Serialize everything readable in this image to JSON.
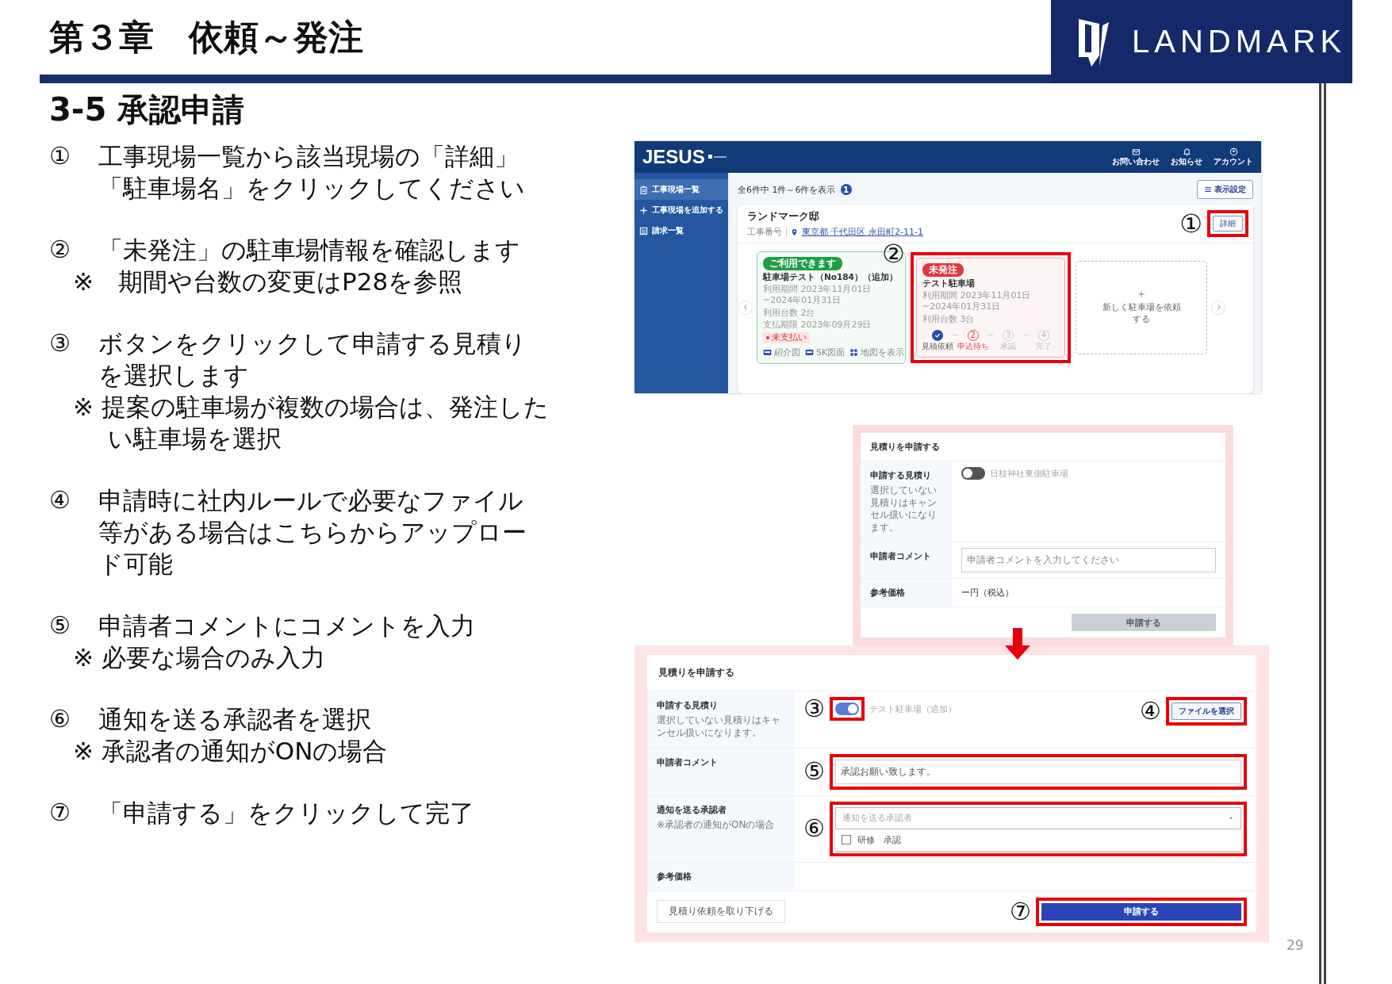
{
  "header": {
    "chapter": "第３章　依頼～発注",
    "logo": "LANDMARK"
  },
  "section_title": "3-5 承認申請",
  "steps": [
    {
      "number": "①",
      "text": "工事現場一覧から該当現場の「詳細」「駐車場名」をクリックしてください"
    },
    {
      "number": "②",
      "text": "「未発注」の駐車場情報を確認します",
      "notes": [
        "※　期間や台数の変更はP28を参照"
      ]
    },
    {
      "number": "③",
      "text": "ボタンをクリックして申請する見積りを選択します",
      "notes": [
        "※ 提案の駐車場が複数の場合は、発注したい駐車場を選択"
      ]
    },
    {
      "number": "④",
      "text": "申請時に社内ルールで必要なファイル等がある場合はこちらからアップロード可能"
    },
    {
      "number": "⑤",
      "text": "申請者コメントにコメントを入力",
      "notes": [
        "※ 必要な場合のみ入力"
      ]
    },
    {
      "number": "⑥",
      "text": "通知を送る承認者を選択",
      "notes": [
        "※ 承認者の通知がONの場合"
      ]
    },
    {
      "number": "⑦",
      "text": "「申請する」をクリックして完了"
    }
  ],
  "screens": {
    "site_list": {
      "brand": "JESUS",
      "nav_actions": [
        {
          "label": "お問い合わせ"
        },
        {
          "label": "お知らせ"
        },
        {
          "label": "アカウント"
        }
      ],
      "sidebar": [
        {
          "label": "工事現場一覧",
          "selected": true
        },
        {
          "label": "工事現場を追加する",
          "selected": false
        },
        {
          "label": "請求一覧",
          "selected": false
        }
      ],
      "count_text": "全6件中 1件～6件を表示",
      "count_badge": "1",
      "display_settings": "表示設定",
      "site": {
        "name": "ランドマーク邸",
        "code_label": "工事番号",
        "address": "東京都 千代田区 永田町2-11-1",
        "detail_button": "詳細",
        "detail_marker": "①"
      },
      "cards": [
        {
          "status": "ご利用できます",
          "color": "#1f9e46",
          "name": "駐車場テスト（No184）（追加）",
          "lines": [
            "利用期間 2023年11月01日~2024年01月31日",
            "利用台数 2台",
            "支払期限 2023年09月29日"
          ],
          "payment_tag": "未支払い",
          "links": [
            "紹介図",
            "SK図面",
            "地図を表示"
          ]
        },
        {
          "status": "未発注",
          "color": "#e0383e",
          "name": "テスト駐車場",
          "lines": [
            "利用期間 2023年11月01日~2024年01月31日",
            "利用台数 3台"
          ],
          "marker": "②",
          "progress": [
            {
              "label": "見積依頼",
              "done": true,
              "current": false
            },
            {
              "number": "2",
              "label": "申込待ち",
              "done": false,
              "current": true
            },
            {
              "number": "3",
              "label": "承認",
              "done": false,
              "current": false
            },
            {
              "number": "4",
              "label": "完了",
              "done": false,
              "current": false
            }
          ]
        }
      ],
      "add_card": "新しく駐車場を依頼する"
    },
    "draft_form": {
      "title": "見積りを申請する",
      "rows": [
        {
          "kind": "toggle",
          "label": "申請する見積り",
          "hint": "選択していない見積りはキャンセル扱いになります。",
          "options": [
            {
              "label": "日枝神社東側駐車場",
              "on": false
            }
          ]
        },
        {
          "kind": "textarea",
          "label": "申請者コメント",
          "placeholder": "申請者コメントを入力してください"
        },
        {
          "kind": "price",
          "label": "参考価格",
          "value": "ー円（税込）"
        }
      ],
      "submit": {
        "label": "申請する",
        "disabled": true
      }
    },
    "apply_form": {
      "title": "見積りを申請する",
      "rows": [
        {
          "kind": "toggle",
          "label": "申請する見積り",
          "hint": "選択していない見積りはキャンセル扱いになります。",
          "marker": "③",
          "options": [
            {
              "label": "テスト駐車場（追加）",
              "on": true
            }
          ],
          "file_button": "ファイルを選択",
          "file_marker": "④"
        },
        {
          "kind": "textarea",
          "label": "申請者コメント",
          "value": "承認お願い致します。",
          "marker": "⑤"
        },
        {
          "kind": "select",
          "label": "通知を送る承認者",
          "hint": "※承認者の通知がONの場合",
          "placeholder": "通知を送る承認者",
          "expanded": true,
          "marker": "⑥",
          "options": [
            {
              "label": "研修　承認",
              "checked": false
            }
          ]
        },
        {
          "kind": "price",
          "label": "参考価格"
        }
      ],
      "withdraw": "見積り依頼を取り下げる",
      "submit": {
        "label": "申請する",
        "disabled": false,
        "marker": "⑦"
      }
    }
  },
  "page_number": "29"
}
